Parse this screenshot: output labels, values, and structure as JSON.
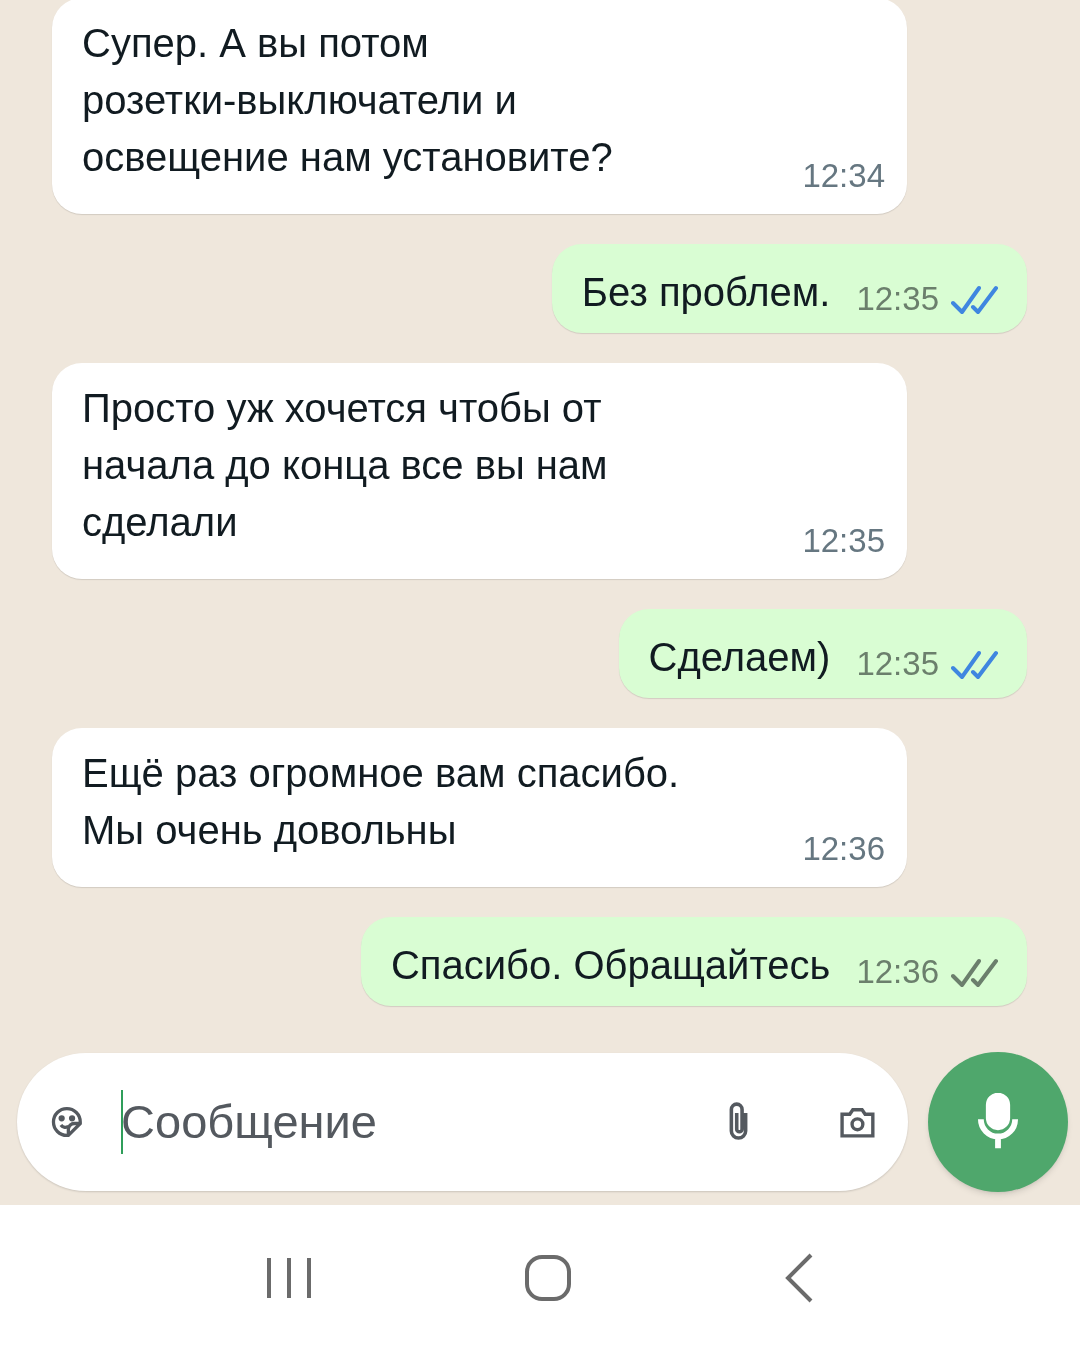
{
  "messages": [
    {
      "kind": "incoming",
      "text": "Супер. А вы потом\nрозетки-выключатели и\nосвещение нам установите?",
      "time": "12:34"
    },
    {
      "kind": "outgoing",
      "text": "Без проблем.",
      "time": "12:35",
      "read": true
    },
    {
      "kind": "incoming",
      "text": "Просто уж хочется чтобы от\nначала до конца все вы нам\nсделали",
      "time": "12:35"
    },
    {
      "kind": "outgoing",
      "text": "Сделаем)",
      "time": "12:35",
      "read": true
    },
    {
      "kind": "incoming",
      "text": "Ещё раз огромное вам спасибо.\nМы очень довольны",
      "time": "12:36"
    },
    {
      "kind": "outgoing",
      "text": "Спасибо. Обращайтесь",
      "time": "12:36",
      "read": false
    }
  ],
  "composer": {
    "placeholder": "Сообщение"
  }
}
